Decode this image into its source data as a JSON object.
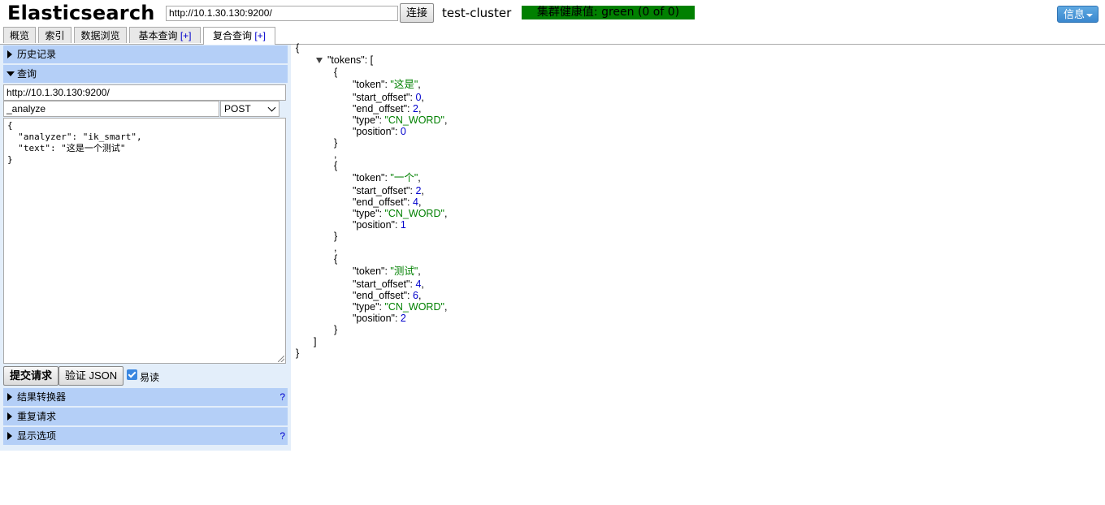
{
  "header": {
    "logo": "Elasticsearch",
    "url": "http://10.1.30.130:9200/",
    "connect_label": "连接",
    "cluster_name": "test-cluster",
    "health": "集群健康值: green (0 of 0)",
    "info_label": "信息"
  },
  "tabs": [
    {
      "label": "概览"
    },
    {
      "label": "索引"
    },
    {
      "label": "数据浏览"
    },
    {
      "label": "基本查询",
      "plus": "[+]"
    },
    {
      "label": "复合查询",
      "plus": "[+]",
      "active": true
    }
  ],
  "left": {
    "history_label": "历史记录",
    "query_label": "查询",
    "query_url": "http://10.1.30.130:9200/",
    "query_path": "_analyze",
    "method": "POST",
    "body": "{\n  \"analyzer\": \"ik_smart\",\n  \"text\": \"这是一个测试\"\n}",
    "submit_label": "提交请求",
    "validate_label": "验证 JSON",
    "easy_read_label": "易读",
    "easy_read_checked": true,
    "transformer_label": "结果转换器",
    "repeat_label": "重复请求",
    "display_label": "显示选项",
    "help": "?"
  },
  "result": {
    "open_brace": "{",
    "tokens_key": "\"tokens\"",
    "tokens_open": ": [",
    "close_bracket": "]",
    "close_brace": "}",
    "items": [
      {
        "token": "\"这是\"",
        "start_offset": "0",
        "end_offset": "2",
        "type": "\"CN_WORD\"",
        "position": "0"
      },
      {
        "token": "\"一个\"",
        "start_offset": "2",
        "end_offset": "4",
        "type": "\"CN_WORD\"",
        "position": "1"
      },
      {
        "token": "\"测试\"",
        "start_offset": "4",
        "end_offset": "6",
        "type": "\"CN_WORD\"",
        "position": "2"
      }
    ],
    "keys": {
      "token": "\"token\"",
      "start_offset": "\"start_offset\"",
      "end_offset": "\"end_offset\"",
      "type": "\"type\"",
      "position": "\"position\""
    }
  },
  "colors": {
    "health_bg": "#008000",
    "section_bar": "#b4cff7",
    "panel_bg": "#e3eefa",
    "info_btn": "#4a97d9"
  }
}
